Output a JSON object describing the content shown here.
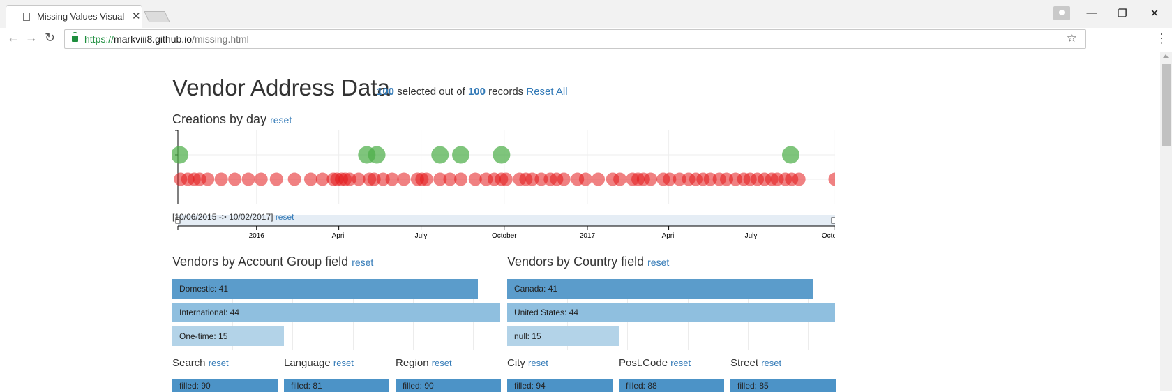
{
  "browser": {
    "tab_title": "Missing Values Visualizat",
    "url_proto": "https://",
    "url_host": "markviii8.github.io",
    "url_path": "/missing.html"
  },
  "page": {
    "title": "Vendor Address Data",
    "selected_count": "100",
    "selected_text": "selected out of",
    "total_count": "100",
    "records_text": "records",
    "reset_all": "Reset All"
  },
  "creations": {
    "title": "Creations by day",
    "reset": "reset",
    "range_text": "[10/06/2015 -> 10/02/2017]",
    "range_reset": "reset"
  },
  "account_group": {
    "title": "Vendors by Account Group field",
    "reset": "reset"
  },
  "country": {
    "title": "Vendors by Country field",
    "reset": "reset"
  },
  "small_charts": [
    {
      "title": "Search",
      "reset": "reset",
      "label": "filled: 90"
    },
    {
      "title": "Language",
      "reset": "reset",
      "label": "filled: 81"
    },
    {
      "title": "Region",
      "reset": "reset",
      "label": "filled: 90"
    },
    {
      "title": "City",
      "reset": "reset",
      "label": "filled: 94"
    },
    {
      "title": "Post.Code",
      "reset": "reset",
      "label": "filled: 88"
    },
    {
      "title": "Street",
      "reset": "reset",
      "label": "filled: 85"
    }
  ],
  "colors": {
    "link": "#337ab7",
    "green": "#4daf4a",
    "red": "#e41a1c",
    "bar_dark": "#3182bd",
    "bar_mid": "#6baed6",
    "bar_light": "#9ecae1"
  },
  "chart_data": [
    {
      "type": "scatter",
      "title": "Creations by day",
      "x_ticks": [
        "2016",
        "April",
        "July",
        "October",
        "2017",
        "April",
        "July",
        "October"
      ],
      "xlim": [
        "2015-10-06",
        "2017-10-02"
      ],
      "series": [
        {
          "color": "green",
          "x": [
            "2015-10-08",
            "2016-05-02",
            "2016-05-13",
            "2016-07-22",
            "2016-08-14",
            "2016-09-28",
            "2017-08-14"
          ]
        },
        {
          "color": "red",
          "x": [
            "2015-10-09",
            "2015-10-17",
            "2015-10-24",
            "2015-10-30",
            "2015-11-08",
            "2015-11-23",
            "2015-12-08",
            "2015-12-23",
            "2016-01-06",
            "2016-01-23",
            "2016-02-12",
            "2016-03-01",
            "2016-03-14",
            "2016-03-26",
            "2016-03-30",
            "2016-04-04",
            "2016-04-08",
            "2016-04-13",
            "2016-04-23",
            "2016-05-05",
            "2016-05-10",
            "2016-05-20",
            "2016-05-30",
            "2016-06-12",
            "2016-06-27",
            "2016-07-02",
            "2016-07-07",
            "2016-07-22",
            "2016-08-02",
            "2016-08-14",
            "2016-08-30",
            "2016-09-11",
            "2016-09-20",
            "2016-09-28",
            "2016-10-03",
            "2016-10-18",
            "2016-10-25",
            "2016-11-01",
            "2016-11-11",
            "2016-11-21",
            "2016-11-28",
            "2016-12-06",
            "2016-12-21",
            "2016-12-30",
            "2017-01-13",
            "2017-01-29",
            "2017-02-06",
            "2017-02-20",
            "2017-02-26",
            "2017-03-04",
            "2017-03-12",
            "2017-03-26",
            "2017-04-02",
            "2017-04-13",
            "2017-04-23",
            "2017-05-01",
            "2017-05-09",
            "2017-05-17",
            "2017-05-27",
            "2017-06-04",
            "2017-06-14",
            "2017-06-23",
            "2017-06-30",
            "2017-07-08",
            "2017-07-16",
            "2017-07-24",
            "2017-07-30",
            "2017-08-08",
            "2017-08-15",
            "2017-08-23",
            "2017-10-02"
          ]
        }
      ]
    },
    {
      "type": "bar",
      "title": "Vendors by Account Group field",
      "categories": [
        "Domestic",
        "International",
        "One-time"
      ],
      "values": [
        41,
        44,
        15
      ],
      "labels": [
        "Domestic: 41",
        "International: 44",
        "One-time: 15"
      ]
    },
    {
      "type": "bar",
      "title": "Vendors by Country field",
      "categories": [
        "Canada",
        "United States",
        "null"
      ],
      "values": [
        41,
        44,
        15
      ],
      "labels": [
        "Canada: 41",
        "United States: 44",
        "null: 15"
      ]
    }
  ]
}
